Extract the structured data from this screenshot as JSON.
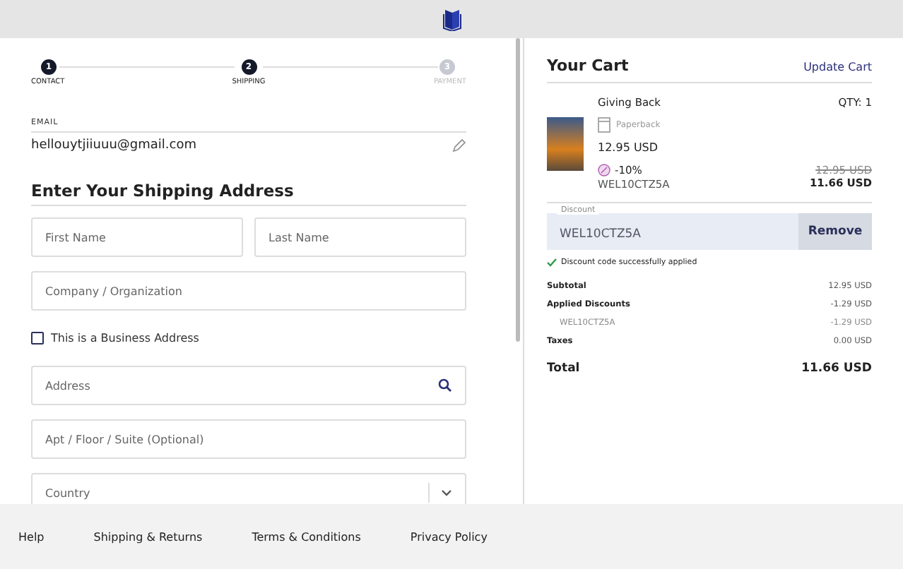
{
  "steps": [
    {
      "number": "1",
      "label": "CONTACT",
      "active": true
    },
    {
      "number": "2",
      "label": "SHIPPING",
      "active": true
    },
    {
      "number": "3",
      "label": "PAYMENT",
      "active": false
    }
  ],
  "email": {
    "label": "EMAIL",
    "value": "hellouytjiiuuu@gmail.com"
  },
  "shipping": {
    "heading": "Enter Your Shipping Address",
    "rows": [
      [
        {
          "kind": "text",
          "placeholder": "First Name"
        },
        {
          "kind": "text",
          "placeholder": "Last Name"
        }
      ],
      [
        {
          "kind": "text",
          "placeholder": "Company / Organization"
        }
      ],
      [
        {
          "kind": "checkbox",
          "label": "This is a Business Address",
          "checked": false
        }
      ],
      [
        {
          "kind": "search",
          "placeholder": "Address"
        }
      ],
      [
        {
          "kind": "text",
          "placeholder": "Apt / Floor / Suite (Optional)"
        }
      ],
      [
        {
          "kind": "select",
          "placeholder": "Country"
        }
      ]
    ]
  },
  "cart": {
    "title": "Your Cart",
    "update_link": "Update Cart",
    "item": {
      "title": "Giving Back",
      "qty": "QTY: 1",
      "format": "Paperback",
      "price": "12.95 USD",
      "discount": "-10%",
      "code": "WEL10CTZ5A",
      "old_price": "12.95 USD",
      "new_price": "11.66 USD"
    },
    "discount_field": {
      "label": "Discount",
      "value": "WEL10CTZ5A",
      "button": "Remove",
      "message": "Discount code successfully applied"
    },
    "summary": [
      {
        "kind": "line",
        "label": "Subtotal",
        "value": "12.95 USD"
      },
      {
        "kind": "line",
        "label": "Applied Discounts",
        "value": "-1.29 USD"
      },
      {
        "kind": "sub",
        "label": "WEL10CTZ5A",
        "value": "-1.29 USD"
      },
      {
        "kind": "line",
        "label": "Taxes",
        "value": "0.00 USD"
      },
      {
        "kind": "total",
        "label": "Total",
        "value": "11.66 USD"
      }
    ]
  },
  "footer": [
    "Help",
    "Shipping & Returns",
    "Terms & Conditions",
    "Privacy Policy"
  ]
}
